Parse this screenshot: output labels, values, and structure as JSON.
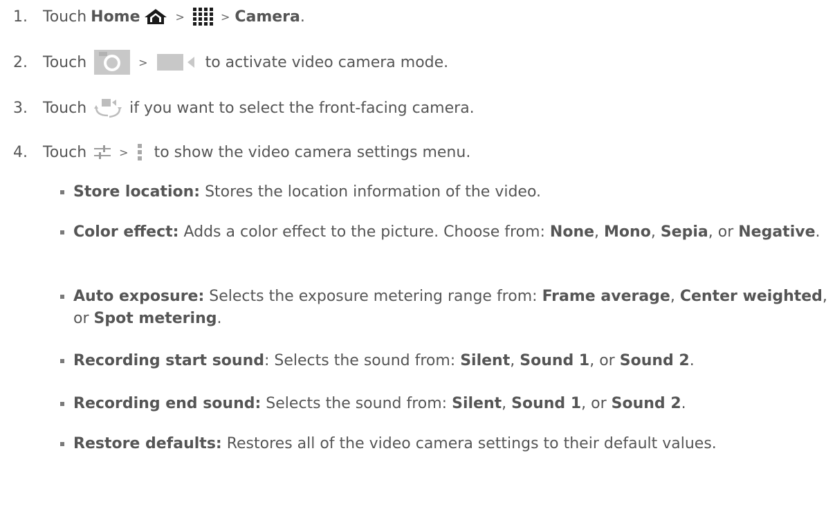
{
  "steps": [
    {
      "number": "1.",
      "touch": "Touch",
      "home": "Home",
      "sep1": ">",
      "sep2": ">",
      "camera": "Camera",
      "period": "."
    },
    {
      "number": "2.",
      "touch": "Touch",
      "sep1": ">",
      "text": "to activate video camera mode."
    },
    {
      "number": "3.",
      "touch": "Touch",
      "text": "if you want to select the front-facing camera."
    },
    {
      "number": "4.",
      "touch": "Touch",
      "sep1": ">",
      "text": "to show the video camera settings menu."
    }
  ],
  "icons": {
    "home": "home-icon",
    "apps": "apps-grid-icon",
    "camera": "camera-icon",
    "video": "video-camera-icon",
    "switch": "switch-camera-icon",
    "settings": "settings-sliders-icon",
    "menu": "more-vert-icon"
  },
  "bullets": [
    {
      "term": "Store location:",
      "text": "Stores the location information of the video."
    },
    {
      "term": "Color effect:",
      "t1": "Adds a color effect to the picture. Choose from:",
      "o1": "None",
      "c1": ",",
      "o2": "Mono",
      "c2": ",",
      "o3": "Sepia",
      "c3": ",",
      "or": "or",
      "o4": "Negative",
      "end": "."
    },
    {
      "term": "Auto exposure:",
      "t1": "Selects the exposure metering range from:",
      "o1": "Frame average",
      "c1": ",",
      "o2": "Center weighted",
      "c2": ", or",
      "o3": "Spot metering",
      "end": "."
    },
    {
      "term": "Recording start sound",
      "t1": ": Selects the sound from:",
      "o1": "Silent",
      "c1": ",",
      "o2": "Sound 1",
      "c2": ", or",
      "o3": "Sound 2",
      "end": "."
    },
    {
      "term": "Recording end sound:",
      "t1": "Selects the sound from:",
      "o1": "Silent",
      "c1": ",",
      "o2": "Sound 1",
      "c2": ", or",
      "o3": "Sound 2",
      "end": "."
    },
    {
      "term": "Restore defaults:",
      "text": "Restores all of the video camera settings to their default values."
    }
  ]
}
